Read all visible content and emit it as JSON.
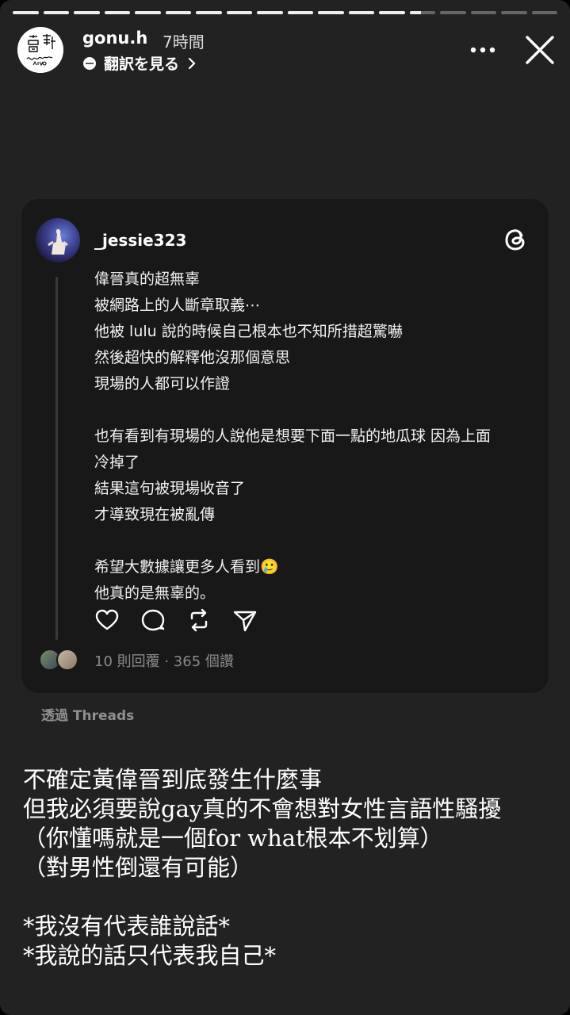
{
  "header": {
    "username": "gonu.h",
    "time": "7時間",
    "translate_label": "翻訳を見る",
    "progress": {
      "total_segments": 18,
      "completed_segments": 13,
      "current_fraction": 0.45
    }
  },
  "embedded_post": {
    "username": "_jessie323",
    "lines": [
      "偉晉真的超無辜",
      "被網路上的人斷章取義⋯",
      "他被 lulu 說的時候自己根本也不知所措超驚嚇",
      "然後超快的解釋他沒那個意思",
      "現場的人都可以作證",
      "",
      "也有看到有現場的人說他是想要下面一點的地瓜球 因為上面",
      "冷掉了",
      "結果這句被現場收音了",
      "才導致現在被亂傳",
      "",
      "希望大數據讓更多人看到🥲",
      "他真的是無辜的。"
    ],
    "stats": "10 則回覆 · 365 個讚",
    "icons": [
      "heart-icon",
      "comment-icon",
      "repost-icon",
      "share-icon",
      "threads-logo-icon"
    ]
  },
  "via_label": "透過 Threads",
  "caption_lines": [
    "不確定黃偉晉到底發生什麼事",
    "但我必須要說gay真的不會想對女性言語性騷擾",
    "（你懂嗎就是一個for what根本不划算）",
    "（對男性倒還有可能）",
    "",
    "*我沒有代表誰說話*",
    "*我說的話只代表我自己*"
  ],
  "colors": {
    "background": "#222222",
    "card": "#181818",
    "muted": "#8a8a8a"
  }
}
